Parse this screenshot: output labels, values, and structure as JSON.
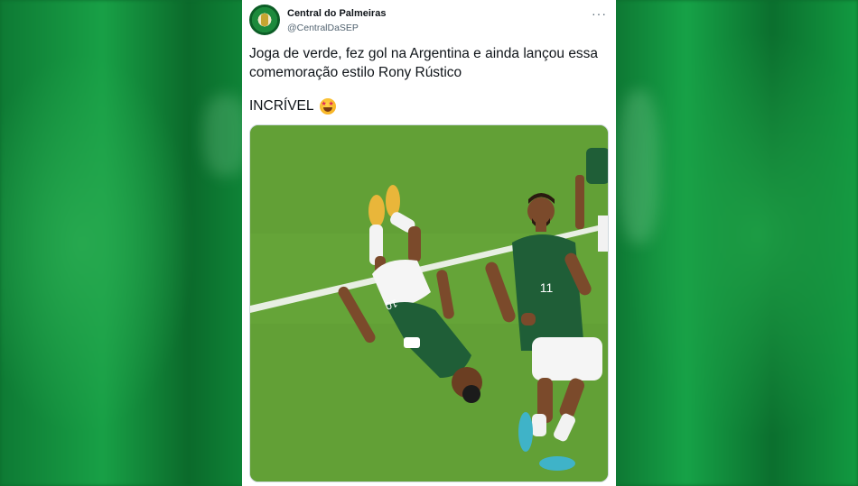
{
  "tweet": {
    "author_name": "Central do Palmeiras",
    "author_handle": "@CentralDaSEP",
    "more_label": "···",
    "text_line1": "Joga de verde, fez gol na Argentina e ainda lançou essa",
    "text_line2": "comemoração estilo Rony Rústico",
    "exclaim": "INCRÍVEL",
    "emoji": "star-struck-emoji-icon",
    "player_numbers": [
      "10",
      "11"
    ]
  },
  "colors": {
    "flag_green": "#0e7a34",
    "jersey_green": "#1f5e37",
    "pitch_green": "#62a036"
  }
}
